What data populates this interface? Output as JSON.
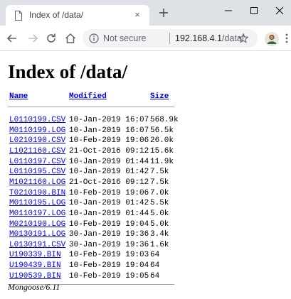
{
  "browser": {
    "tab": {
      "title": "Index of /data/",
      "close_glyph": "×",
      "icon": "page-icon"
    },
    "new_tab_icon": "plus-icon",
    "window_controls": [
      "minimize-icon",
      "maximize-icon",
      "close-icon"
    ],
    "nav_icons": [
      "back-arrow-icon",
      "forward-arrow-icon",
      "reload-icon",
      "home-icon"
    ],
    "omnibox": {
      "security_label": "Not secure",
      "url_host": "192.168.4.1",
      "url_path": "/data/",
      "info_icon": "info-icon",
      "bookmark_icon": "star-icon"
    },
    "profile_icon": "avatar",
    "menu_icon": "kebab-menu-icon"
  },
  "page": {
    "title": "Index of /data/",
    "columns": {
      "name": "Name",
      "modified": "Modified",
      "size": "Size"
    },
    "files": [
      {
        "name": "L0110199.CSV",
        "modified": "10-Jan-2019 16:07",
        "size": "568.9k"
      },
      {
        "name": "M0110199.LOG",
        "modified": "10-Jan-2019 16:07",
        "size": "56.5k"
      },
      {
        "name": "L0210190.CSV",
        "modified": "10-Feb-2019 19:06",
        "size": "26.0k"
      },
      {
        "name": "L1021160.CSV",
        "modified": "21-Oct-2016 09:12",
        "size": "15.6k"
      },
      {
        "name": "L0110197.CSV",
        "modified": "10-Jan-2019 01:44",
        "size": "11.9k"
      },
      {
        "name": "L0110195.CSV",
        "modified": "10-Jan-2019 01:42",
        "size": "7.5k"
      },
      {
        "name": "M1021160.LOG",
        "modified": "21-Oct-2016 09:12",
        "size": "7.5k"
      },
      {
        "name": "T0210190.BIN",
        "modified": "10-Feb-2019 19:06",
        "size": "7.0k"
      },
      {
        "name": "M0110195.LOG",
        "modified": "10-Jan-2019 01:42",
        "size": "5.5k"
      },
      {
        "name": "M0110197.LOG",
        "modified": "10-Jan-2019 01:44",
        "size": "5.0k"
      },
      {
        "name": "M0210190.LOG",
        "modified": "10-Feb-2019 19:04",
        "size": "5.0k"
      },
      {
        "name": "M0130191.LOG",
        "modified": "30-Jan-2019 19:36",
        "size": "3.4k"
      },
      {
        "name": "L0130191.CSV",
        "modified": "30-Jan-2019 19:36",
        "size": "1.6k"
      },
      {
        "name": "U190339.BIN",
        "modified": "10-Feb-2019 19:03",
        "size": "64"
      },
      {
        "name": "U190439.BIN",
        "modified": "10-Feb-2019 19:04",
        "size": "64"
      },
      {
        "name": "U190539.BIN",
        "modified": "10-Feb-2019 19:05",
        "size": "64"
      }
    ],
    "footer": "Mongoose/6.11"
  },
  "colors": {
    "link": "#0000ee",
    "tabstrip": "#dee1e6",
    "omnibox": "#f1f3f4"
  }
}
